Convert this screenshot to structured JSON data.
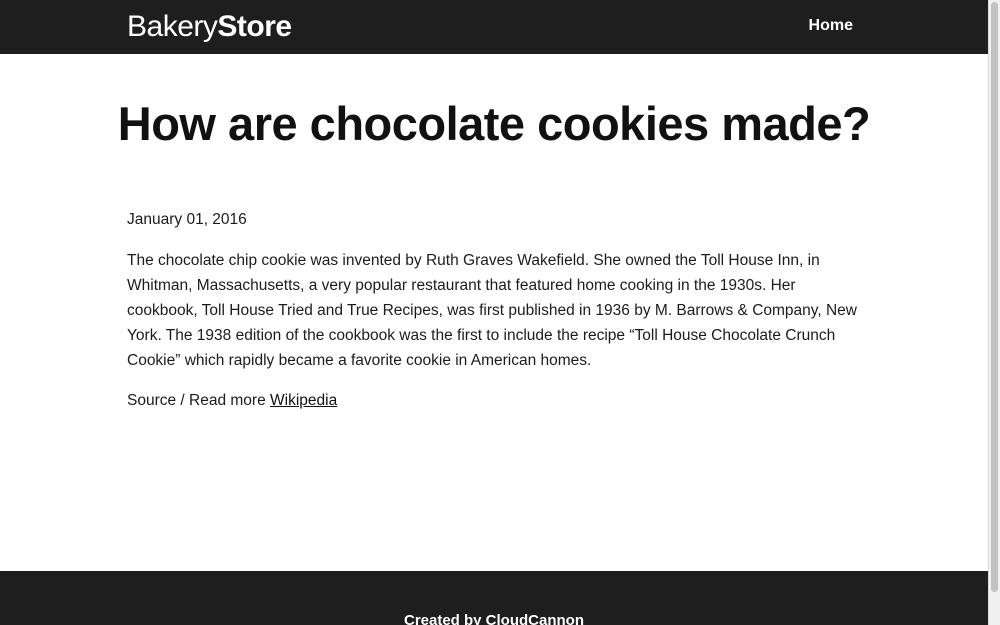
{
  "header": {
    "logo_light": "Bakery",
    "logo_bold": "Store",
    "nav_home": "Home"
  },
  "post": {
    "title": "How are chocolate cookies made?",
    "date": "January 01, 2016",
    "body": "The chocolate chip cookie was invented by Ruth Graves Wakefield. She owned the Toll House Inn, in Whitman, Massachusetts, a very popular restaurant that featured home cooking in the 1930s. Her cookbook, Toll House Tried and True Recipes, was first published in 1936 by M. Barrows & Company, New York. The 1938 edition of the cookbook was the first to include the recipe “Toll House Chocolate Crunch Cookie” which rapidly became a favorite cookie in American homes.",
    "source_prefix": "Source / Read more",
    "source_link": "Wikipedia"
  },
  "footer": {
    "text": "Created by CloudCannon"
  },
  "colors": {
    "header_bg": "#1e1e1e",
    "footer_bg": "#1e1e1e",
    "text": "#1c1c1c"
  }
}
